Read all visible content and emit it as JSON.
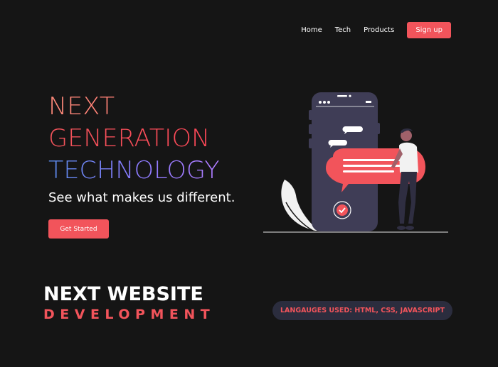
{
  "nav": {
    "items": [
      "Home",
      "Tech",
      "Products"
    ],
    "signup_label": "Sign up"
  },
  "hero": {
    "line1": "NEXT",
    "line2": "GENERATION",
    "line3": "TECHNOLOGY",
    "tagline": "See what makes us different.",
    "cta_label": "Get Started"
  },
  "section": {
    "title_line1": "NEXT WEBSITE",
    "title_line2": "DEVELOPMENT",
    "languages_label": "LANGAUGES USED: HTML, CSS, JAVASCRIPT"
  },
  "colors": {
    "accent": "#f2545b",
    "background": "#151515",
    "pill": "#2b2d3e",
    "phone": "#3f3d56"
  }
}
